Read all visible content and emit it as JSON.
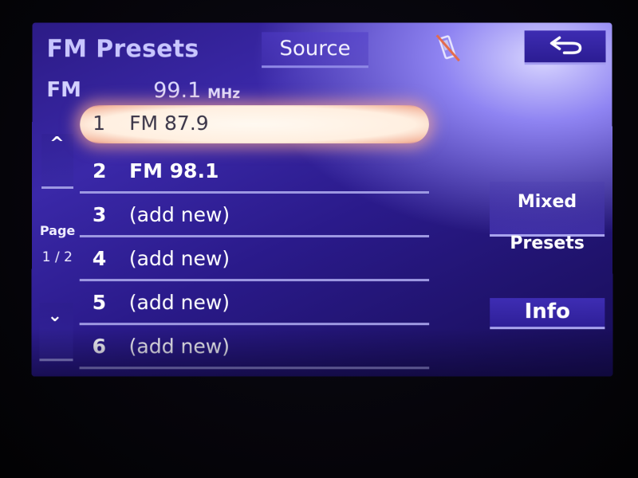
{
  "header": {
    "title": "FM Presets",
    "source_label": "Source",
    "phone_icon": "phone-disconnected-icon",
    "back_icon": "back-arrow-icon"
  },
  "tuner": {
    "band": "FM",
    "frequency": "99.1",
    "unit": "MHz"
  },
  "presets": [
    {
      "num": "1",
      "label": "FM  87.9",
      "selected": true
    },
    {
      "num": "2",
      "label": "FM  98.1"
    },
    {
      "num": "3",
      "label": "(add new)"
    },
    {
      "num": "4",
      "label": "(add new)"
    },
    {
      "num": "5",
      "label": "(add new)"
    },
    {
      "num": "6",
      "label": "(add new)"
    }
  ],
  "pager": {
    "up_glyph": "^",
    "down_glyph": "⌄",
    "page_label": "Page",
    "page_value": "1 / 2"
  },
  "side_buttons": {
    "mixed_presets": "Mixed Presets",
    "info": "Info"
  },
  "colors": {
    "screen_blue": "#2c1b86",
    "accent_line": "#9d98e2",
    "title_text": "#c8c5ff",
    "selected_glow": "#f4b8a0"
  }
}
